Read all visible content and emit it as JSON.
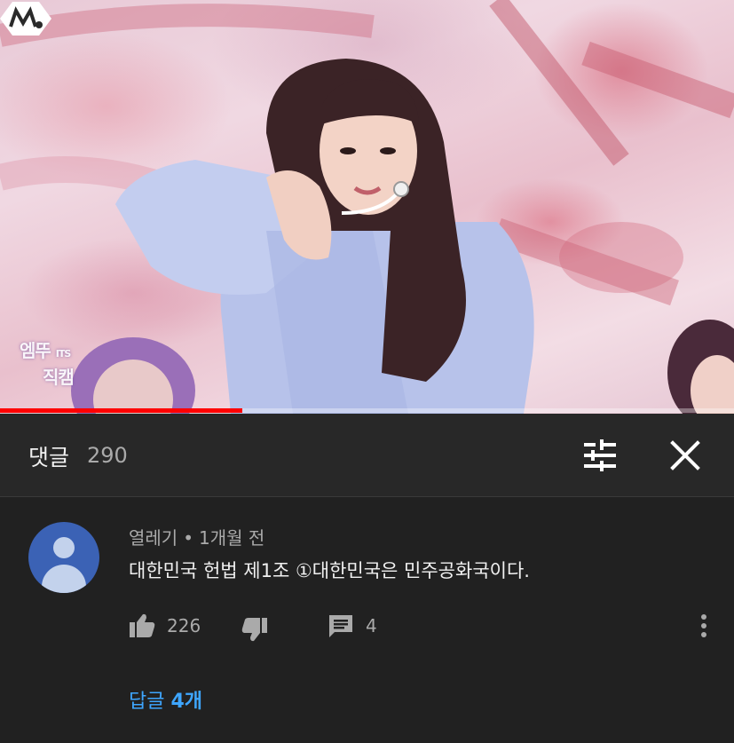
{
  "video": {
    "watermark_line1": "엠뚜",
    "watermark_small": "ITS",
    "watermark_line2": "직캠",
    "progress": 0.33
  },
  "comments": {
    "title": "댓글",
    "count": "290",
    "sort_icon": "sort-filter-icon",
    "close_icon": "close-icon"
  },
  "comment": {
    "author": "열레기",
    "separator": "•",
    "time": "1개월 전",
    "text": "대한민국 헌법 제1조 ①대한민국은 민주공화국이다.",
    "likes": "226",
    "replies_count": "4",
    "view_replies_label": "답글",
    "view_replies_count": "4개"
  },
  "colors": {
    "accent": "#3ea6ff",
    "progress": "#ff0000",
    "avatar": "#3b62b5"
  }
}
